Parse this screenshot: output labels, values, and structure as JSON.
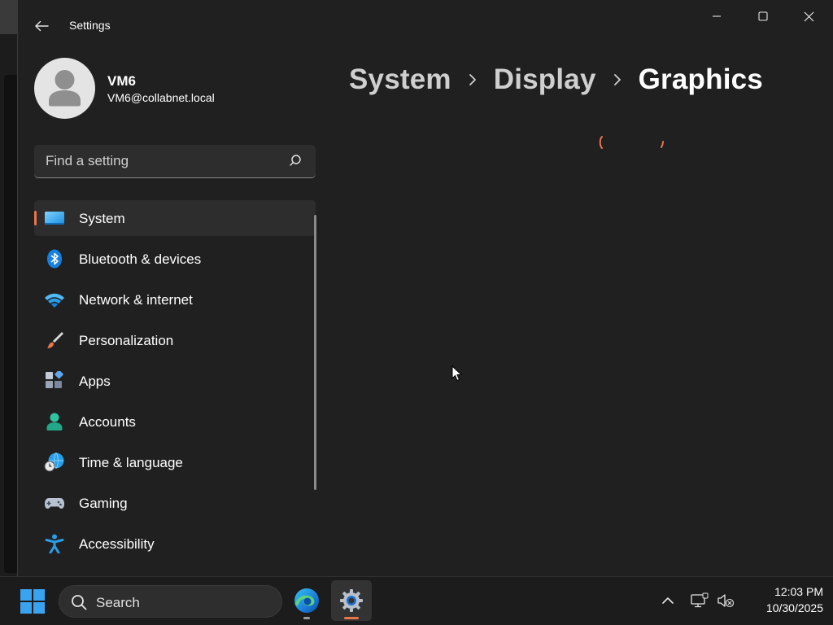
{
  "window": {
    "title": "Settings",
    "back_icon": "back-arrow-icon",
    "controls": [
      "minimize-icon",
      "maximize-icon",
      "close-icon"
    ]
  },
  "account": {
    "name": "VM6",
    "email": "VM6@collabnet.local",
    "avatar_icon": "person-icon"
  },
  "search": {
    "placeholder": "Find a setting",
    "value": "",
    "icon": "search-icon"
  },
  "nav": {
    "selected_index": 0,
    "accent_color": "#e8754b",
    "items": [
      {
        "label": "System",
        "icon": "monitor-icon"
      },
      {
        "label": "Bluetooth & devices",
        "icon": "bluetooth-icon"
      },
      {
        "label": "Network & internet",
        "icon": "wifi-icon"
      },
      {
        "label": "Personalization",
        "icon": "paintbrush-icon"
      },
      {
        "label": "Apps",
        "icon": "apps-icon"
      },
      {
        "label": "Accounts",
        "icon": "person-icon"
      },
      {
        "label": "Time & language",
        "icon": "globe-clock-icon"
      },
      {
        "label": "Gaming",
        "icon": "gamepad-icon"
      },
      {
        "label": "Accessibility",
        "icon": "accessibility-icon"
      }
    ]
  },
  "breadcrumb": {
    "items": [
      "System",
      "Display",
      "Graphics"
    ],
    "separator_icon": "chevron-right-icon"
  },
  "content": {
    "loading": true,
    "spinner_icon": "loading-spinner-icon"
  },
  "taskbar": {
    "search_label": "Search",
    "apps": [
      {
        "name": "Microsoft Edge",
        "icon": "edge-icon",
        "active": false
      },
      {
        "name": "Settings",
        "icon": "gear-icon",
        "active": true
      }
    ],
    "tray_icons": [
      "chevron-up-icon",
      "network-icon",
      "volume-muted-icon"
    ],
    "time": "12:03 PM",
    "date": "10/30/2025"
  }
}
